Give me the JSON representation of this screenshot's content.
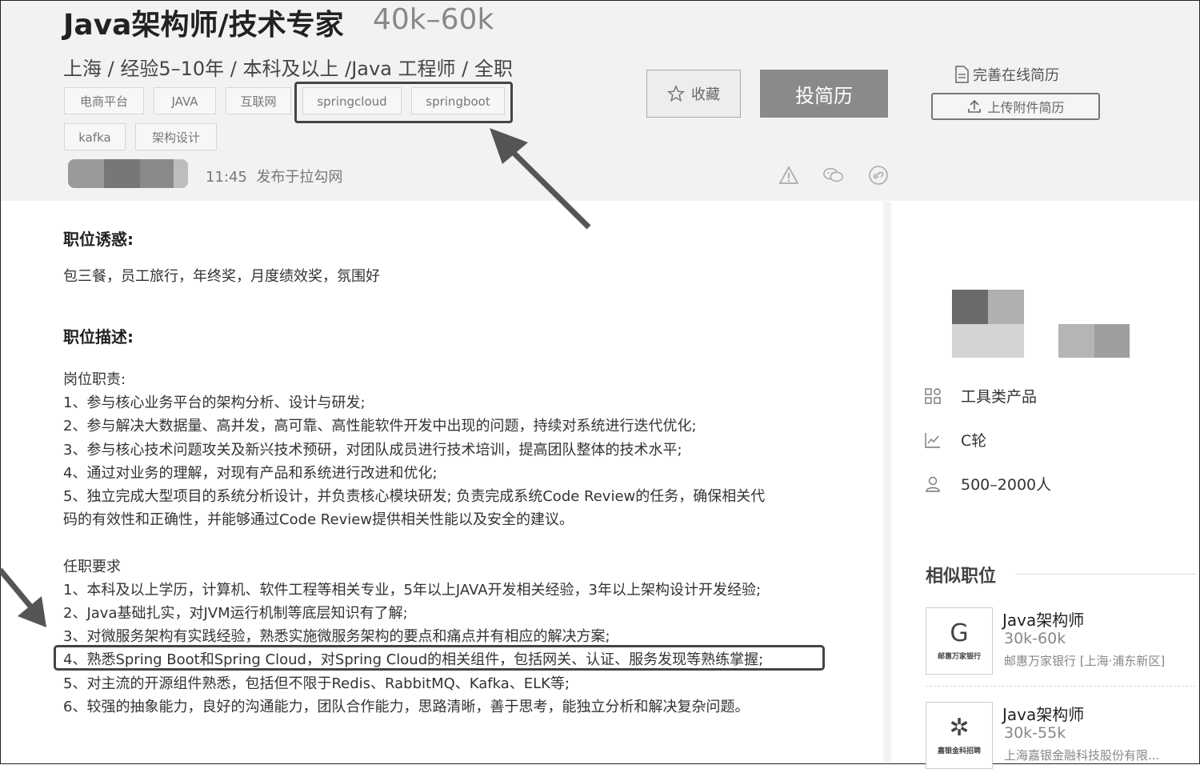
{
  "job": {
    "title": "Java架构师/技术专家",
    "salary": "40k–60k",
    "meta": "上海 / 经验5–10年 / 本科及以上 /Java 工程师 / 全职",
    "tags": [
      "电商平台",
      "JAVA",
      "互联网",
      "springcloud",
      "springboot",
      "kafka",
      "架构设计"
    ],
    "publish_time": "11:45",
    "publish_source": "发布于拉勾网"
  },
  "actions": {
    "favorite_label": "收藏",
    "apply_label": "投简历",
    "improve_resume_label": "完善在线简历",
    "upload_resume_label": "上传附件简历"
  },
  "content": {
    "perks_heading": "职位诱惑:",
    "perks_text": "包三餐，员工旅行，年终奖，月度绩效奖，氛围好",
    "desc_heading": "职位描述:",
    "duties_heading": "岗位职责:",
    "duties": [
      "1、参与核心业务平台的架构分析、设计与研发;",
      "2、参与解决大数据量、高并发，高可靠、高性能软件开发中出现的问题，持续对系统进行迭代优化;",
      "3、参与核心技术问题攻关及新兴技术预研，对团队成员进行技术培训，提高团队整体的技术水平;",
      "4、通过对业务的理解，对现有产品和系统进行改进和优化;",
      "5、独立完成大型项目的系统分析设计，并负责核心模块研发;  负责完成系统Code Review的任务，确保相关代",
      "码的有效性和正确性，并能够通过Code Review提供相关性能以及安全的建议。"
    ],
    "requirements_heading": "任职要求",
    "requirements": [
      "1、本科及以上学历，计算机、软件工程等相关专业，5年以上JAVA开发相关经验，3年以上架构设计开发经验;",
      "2、Java基础扎实，对JVM运行机制等底层知识有了解;",
      "3、对微服务架构有实践经验，熟悉实施微服务架构的要点和痛点并有相应的解决方案;",
      "4、熟悉Spring Boot和Spring Cloud，对Spring Cloud的相关组件，包括网关、认证、服务发现等熟练掌握;",
      "5、对主流的开源组件熟悉，包括但不限于Redis、RabbitMQ、Kafka、ELK等;",
      "6、较强的抽象能力，良好的沟通能力，团队合作能力，思路清晰，善于思考，能独立分析和解决复杂问题。"
    ]
  },
  "company": {
    "industry": "工具类产品",
    "stage": "C轮",
    "size": "500–2000人"
  },
  "similar": {
    "heading": "相似职位",
    "jobs": [
      {
        "title": "Java架构师",
        "salary": "30k-60k",
        "company": "邮惠万家银行 [上海·浦东新区]",
        "logo_text": "邮惠万家银行",
        "logo_mark": "G"
      },
      {
        "title": "Java架构师",
        "salary": "30k-55k",
        "company": "上海嘉银金融科技股份有限...",
        "logo_text": "嘉银金科招聘",
        "logo_mark": "✲"
      }
    ]
  },
  "icons": {
    "report": "warning-icon",
    "wechat": "wechat-icon",
    "link": "link-icon",
    "star": "star-icon",
    "document": "document-icon",
    "upload": "upload-icon",
    "industry": "grid-icon",
    "stage": "chart-line-icon",
    "size": "user-icon"
  }
}
